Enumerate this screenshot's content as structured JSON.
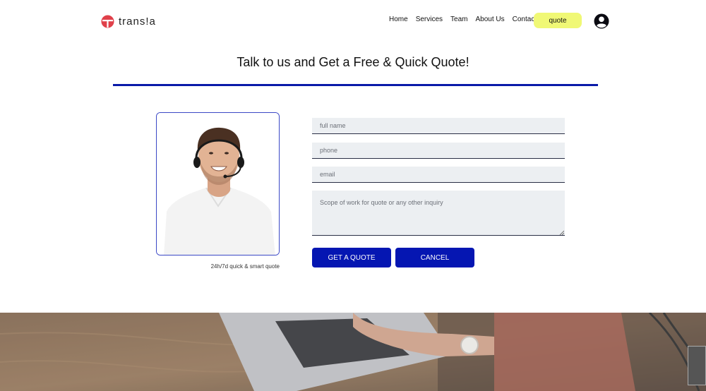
{
  "brand": {
    "name": "trans!a",
    "logo_color": "#e0404a"
  },
  "nav": {
    "items": [
      "Home",
      "Services",
      "Team",
      "About Us",
      "Contact"
    ],
    "quote_label": "quote"
  },
  "page": {
    "title": "Talk to us and Get a Free & Quick Quote!",
    "accent_color": "#0516b2"
  },
  "photo": {
    "caption": "24h/7d quick & smart quote"
  },
  "form": {
    "full_name_placeholder": "full name",
    "phone_placeholder": "phone",
    "email_placeholder": "email",
    "scope_placeholder": "Scope of work for quote or any other inquiry",
    "submit_label": "GET A QUOTE",
    "cancel_label": "CANCEL"
  },
  "icons": {
    "logo": "brand-logo-icon",
    "account": "user-account-icon"
  }
}
